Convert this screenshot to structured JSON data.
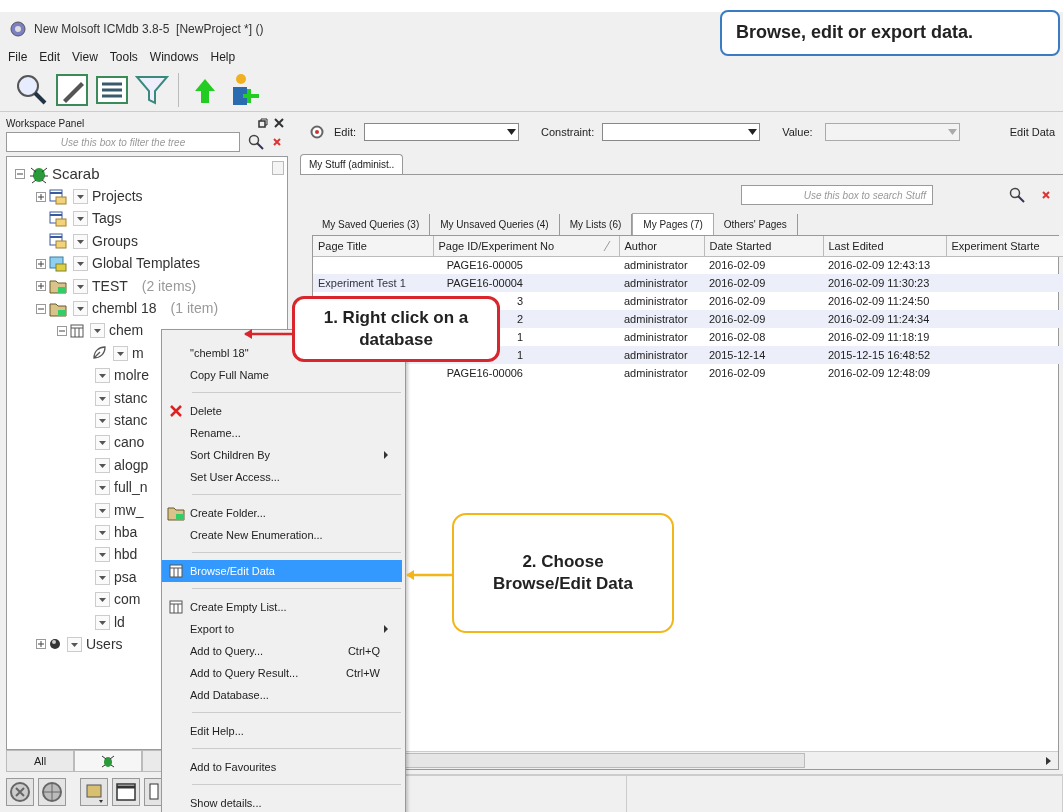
{
  "window": {
    "title": "New Molsoft ICMdb 3.8-5  [NewProject *] ()"
  },
  "menu_bar": [
    "File",
    "Edit",
    "View",
    "Tools",
    "Windows",
    "Help"
  ],
  "workspace_panel": {
    "title": "Workspace Panel",
    "filter": {
      "placeholder": "Use this box to filter the tree"
    },
    "tree": [
      {
        "label": "Scarab",
        "kind": "root",
        "expanded": true,
        "children": [
          {
            "label": "Projects",
            "kind": "collection",
            "expanded": false
          },
          {
            "label": "Tags",
            "kind": "collection"
          },
          {
            "label": "Groups",
            "kind": "collection"
          },
          {
            "label": "Global Templates",
            "kind": "template",
            "expanded": false
          },
          {
            "label": "TEST",
            "count": "(2 items)",
            "kind": "folder",
            "expanded": false
          },
          {
            "label": "chembl 18",
            "count": "(1 item)",
            "kind": "folder",
            "expanded": true,
            "children": [
              {
                "label": "chem",
                "kind": "database",
                "expanded": true,
                "children": [
                  {
                    "label": "m",
                    "kind": "query"
                  },
                  {
                    "label": "molre",
                    "kind": "field"
                  },
                  {
                    "label": "stanc",
                    "kind": "field"
                  },
                  {
                    "label": "stanc",
                    "kind": "field"
                  },
                  {
                    "label": "cano",
                    "kind": "field"
                  },
                  {
                    "label": "alogp",
                    "kind": "field"
                  },
                  {
                    "label": "full_n",
                    "kind": "field"
                  },
                  {
                    "label": "mw_",
                    "kind": "field"
                  },
                  {
                    "label": "hba",
                    "kind": "field"
                  },
                  {
                    "label": "hbd",
                    "kind": "field"
                  },
                  {
                    "label": "psa",
                    "kind": "field"
                  },
                  {
                    "label": "com",
                    "kind": "field"
                  },
                  {
                    "label": "ld",
                    "kind": "field"
                  }
                ]
              }
            ]
          },
          {
            "label": "Users",
            "kind": "users",
            "expanded": false
          }
        ]
      }
    ],
    "bottom_tabs": [
      {
        "label": "All"
      }
    ]
  },
  "query_bar": {
    "fields": [
      {
        "label": "Edit:",
        "disabled": false
      },
      {
        "label": "Constraint:",
        "disabled": false
      },
      {
        "label": "Value:",
        "disabled": true
      }
    ],
    "action": "Edit Data"
  },
  "document_tabs": [
    {
      "label": "My Stuff (administ..",
      "selected": true
    }
  ],
  "stuff_search": {
    "placeholder": "Use this box to search Stuff"
  },
  "stuff_tabs": [
    {
      "label": "My Saved Queries (3)",
      "selected": false
    },
    {
      "label": "My Unsaved Queries (4)",
      "selected": false
    },
    {
      "label": "My Lists (6)",
      "selected": false
    },
    {
      "label": "My Pages (7)",
      "selected": true
    },
    {
      "label": "Others' Pages",
      "selected": false
    }
  ],
  "table": {
    "columns": [
      "Page Title",
      "Page ID/Experiment No",
      "Author",
      "Date Started",
      "Last Edited",
      "Experiment Starte"
    ],
    "rows": [
      {
        "page_id": "PAGE16-00005",
        "author": "administrator",
        "date_started": "2016-02-09",
        "last_edited": "2016-02-09 12:43:13"
      },
      {
        "page_title": "Experiment Test 1",
        "page_id": "PAGE16-00004",
        "author": "administrator",
        "date_started": "2016-02-09",
        "last_edited": "2016-02-09 11:30:23"
      },
      {
        "page_id": "3",
        "author": "administrator",
        "date_started": "2016-02-09",
        "last_edited": "2016-02-09 11:24:50"
      },
      {
        "page_id": "2",
        "author": "administrator",
        "date_started": "2016-02-09",
        "last_edited": "2016-02-09 11:24:34"
      },
      {
        "page_id": "1",
        "author": "administrator",
        "date_started": "2016-02-08",
        "last_edited": "2016-02-09 11:18:19"
      },
      {
        "page_id": "1",
        "author": "administrator",
        "date_started": "2015-12-14",
        "last_edited": "2015-12-15 16:48:52"
      },
      {
        "page_id": "PAGE16-00006",
        "author": "administrator",
        "date_started": "2016-02-09",
        "last_edited": "2016-02-09 12:48:09"
      }
    ]
  },
  "context_menu": {
    "items": [
      {
        "kind": "plain",
        "label": "\"chembl 18\"",
        "selected": false,
        "submenu": false
      },
      {
        "kind": "plain",
        "label": "Copy Full Name",
        "selected": false,
        "submenu": false
      },
      {
        "kind": "separator"
      },
      {
        "kind": "cross",
        "label": "Delete",
        "selected": false,
        "submenu": false
      },
      {
        "kind": "plain",
        "label": "Rename...",
        "selected": false,
        "submenu": false
      },
      {
        "kind": "plain",
        "label": "Sort Children By",
        "selected": false,
        "submenu": true
      },
      {
        "kind": "plain",
        "label": "Set User Access...",
        "selected": false,
        "submenu": false
      },
      {
        "kind": "separator"
      },
      {
        "kind": "folder",
        "label": "Create Folder...",
        "selected": false,
        "submenu": false
      },
      {
        "kind": "plain",
        "label": "Create New Enumeration...",
        "selected": false,
        "submenu": false
      },
      {
        "kind": "separator"
      },
      {
        "kind": "grid",
        "label": "Browse/Edit Data",
        "selected": true,
        "submenu": false
      },
      {
        "kind": "separator"
      },
      {
        "kind": "grid",
        "label": "Create Empty List...",
        "selected": false,
        "submenu": false
      },
      {
        "kind": "plain",
        "label": "Export to",
        "selected": false,
        "submenu": true
      },
      {
        "kind": "plain",
        "label": "Add to Query...",
        "shortcut": "Ctrl+Q",
        "selected": false,
        "submenu": false
      },
      {
        "kind": "plain",
        "label": "Add to Query Result...",
        "shortcut": "Ctrl+W",
        "selected": false,
        "submenu": false
      },
      {
        "kind": "plain",
        "label": "Add Database...",
        "selected": false,
        "submenu": false
      },
      {
        "kind": "separator"
      },
      {
        "kind": "plain",
        "label": "Edit Help...",
        "selected": false,
        "submenu": false
      },
      {
        "kind": "separator"
      },
      {
        "kind": "plain",
        "label": "Add to Favourites",
        "selected": false,
        "submenu": false
      },
      {
        "kind": "separator"
      },
      {
        "kind": "plain",
        "label": "Show details...",
        "selected": false,
        "submenu": false
      }
    ]
  },
  "callouts": [
    {
      "kind": "tip",
      "text": "Browse, edit or export data.",
      "color": "#3a7cc4"
    },
    {
      "kind": "step-one",
      "text": "1. Right click on a database",
      "color": "#d9262c"
    },
    {
      "kind": "step-two",
      "text": "2. Choose Browse/Edit Data",
      "color": "#f2b619"
    }
  ]
}
